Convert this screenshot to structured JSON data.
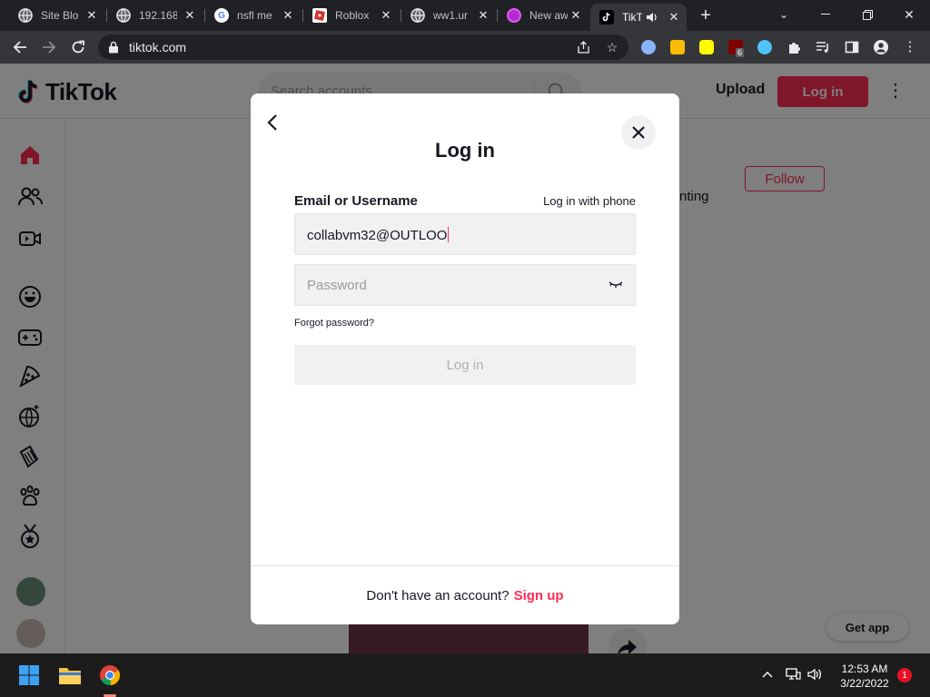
{
  "browser": {
    "tabs": [
      {
        "title": "Site Blo",
        "favicon": "globe-icon"
      },
      {
        "title": "192.168",
        "favicon": "globe-icon"
      },
      {
        "title": "nsfl me",
        "favicon": "google-icon"
      },
      {
        "title": "Roblox",
        "favicon": "roblox-icon"
      },
      {
        "title": "ww1.ur",
        "favicon": "globe-icon"
      },
      {
        "title": "New aw",
        "favicon": "purple-circle-icon"
      },
      {
        "title": "TikT",
        "favicon": "tiktok-icon",
        "active": true,
        "audio": true
      }
    ],
    "url": "tiktok.com",
    "extension_badge": "6"
  },
  "tiktok": {
    "logo_text": "TikTok",
    "search_placeholder": "Search accounts",
    "upload_label": "Upload",
    "login_label": "Log in",
    "follow_label": "Follow",
    "background_text": "nting",
    "get_app_label": "Get app",
    "accent_color": "#fe2c55"
  },
  "modal": {
    "title": "Log in",
    "email_label": "Email or Username",
    "phone_link": "Log in with phone",
    "email_value": "collabvm32@OUTLOO",
    "password_placeholder": "Password",
    "forgot_link": "Forgot password?",
    "submit_label": "Log in",
    "footer_text": "Don't have an account?",
    "signup_link": "Sign up"
  },
  "taskbar": {
    "time": "12:53 AM",
    "date": "3/22/2022",
    "notification_count": "1"
  }
}
